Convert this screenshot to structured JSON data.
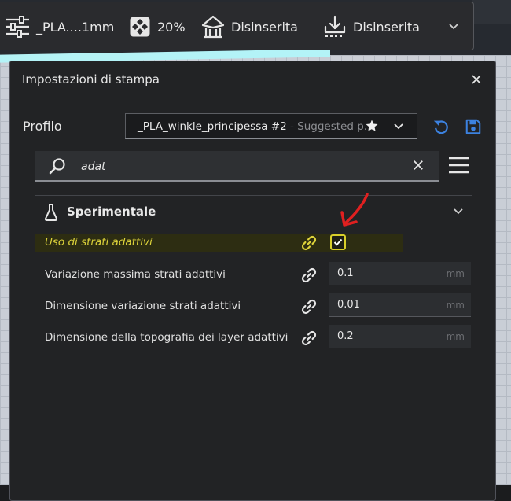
{
  "toolbar": {
    "profile": "_PLA....1mm",
    "infill": "20%",
    "support": "Disinserita",
    "adhesion": "Disinserita"
  },
  "panel": {
    "title": "Impostazioni di stampa",
    "profile_label": "Profilo",
    "profile_name": "_PLA_winkle_principessa #2",
    "profile_suggested": " - Suggested p...",
    "search_value": "adat",
    "category": "Sperimentale",
    "settings": [
      {
        "label": "Uso di strati adattivi",
        "type": "checkbox",
        "checked": true,
        "highlighted": true
      },
      {
        "label": "Variazione massima strati adattivi",
        "value": "0.1",
        "unit": "mm"
      },
      {
        "label": "Dimensione variazione strati adattivi",
        "value": "0.01",
        "unit": "mm"
      },
      {
        "label": "Dimensione della topografia dei layer adattivi",
        "value": "0.2",
        "unit": "mm"
      }
    ]
  },
  "colors": {
    "accent_blue": "#3c82e0",
    "highlight_yellow": "#ddd33a",
    "arrow_red": "#e02020"
  }
}
